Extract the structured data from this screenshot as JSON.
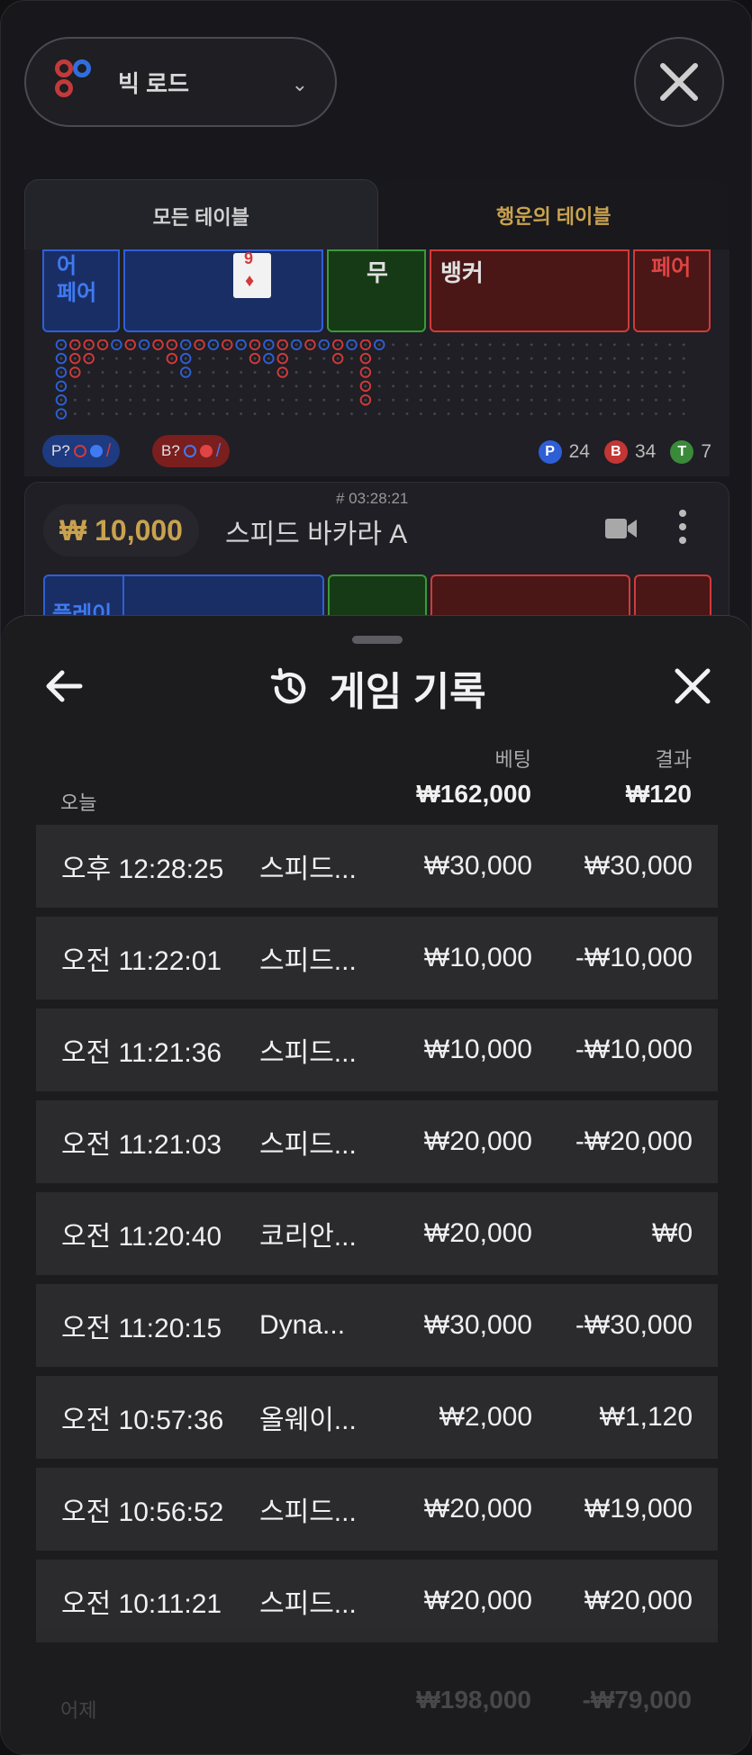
{
  "header": {
    "road_select_label": "빅 로드",
    "tabs": [
      "모든 테이블",
      "행운의 테이블"
    ]
  },
  "table1": {
    "bet_labels": {
      "player_pair": "어\n페어",
      "tie": "무",
      "banker": "뱅커",
      "banker_pair": "뱅커\n페어"
    },
    "card_rank": "9",
    "predict_player": "P?",
    "predict_banker": "B?",
    "stats": {
      "player": 24,
      "banker": 34,
      "tie": 7
    },
    "stat_letters": {
      "player": "P",
      "banker": "B",
      "tie": "T"
    }
  },
  "table2": {
    "round": "# 03:28:21",
    "stake": "₩ 10,000",
    "name": "스피드 바카라 A",
    "player_label": "플레이"
  },
  "history": {
    "title": "게임 기록",
    "col_bet": "베팅",
    "col_result": "결과",
    "today_label": "오늘",
    "today_bet_total": "₩162,000",
    "today_result_total": "₩120",
    "rows": [
      {
        "time": "오후 12:28:25",
        "game": "스피드...",
        "bet": "₩30,000",
        "result": "₩30,000"
      },
      {
        "time": "오전 11:22:01",
        "game": "스피드...",
        "bet": "₩10,000",
        "result": "-₩10,000"
      },
      {
        "time": "오전 11:21:36",
        "game": "스피드...",
        "bet": "₩10,000",
        "result": "-₩10,000"
      },
      {
        "time": "오전 11:21:03",
        "game": "스피드...",
        "bet": "₩20,000",
        "result": "-₩20,000"
      },
      {
        "time": "오전 11:20:40",
        "game": "코리안...",
        "bet": "₩20,000",
        "result": "₩0"
      },
      {
        "time": "오전 11:20:15",
        "game": "Dyna...",
        "bet": "₩30,000",
        "result": "-₩30,000"
      },
      {
        "time": "오전 10:57:36",
        "game": "올웨이...",
        "bet": "₩2,000",
        "result": "₩1,120"
      },
      {
        "time": "오전 10:56:52",
        "game": "스피드...",
        "bet": "₩20,000",
        "result": "₩19,000"
      },
      {
        "time": "오전 10:11:21",
        "game": "스피드...",
        "bet": "₩20,000",
        "result": "₩20,000"
      }
    ],
    "yesterday_label": "어제",
    "yesterday_bet_total": "₩198,000",
    "yesterday_result_total": "-₩79,000"
  },
  "colors": {
    "player_blue": "#2f5fd6",
    "banker_red": "#d23a3a",
    "tie_green": "#3a9a3a",
    "gold": "#c9a24f"
  }
}
